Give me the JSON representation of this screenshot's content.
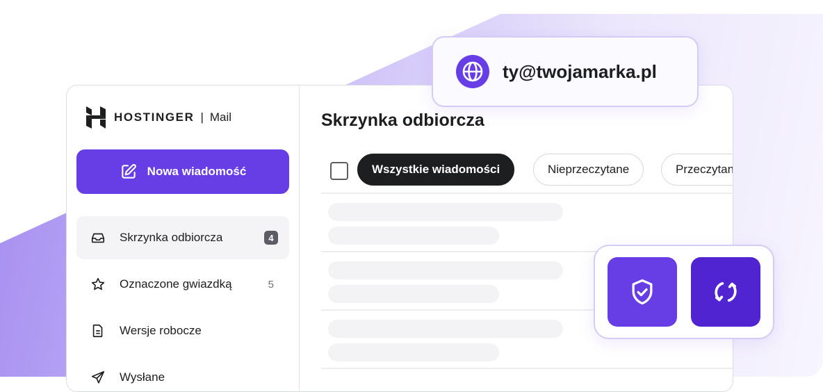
{
  "brand": {
    "name": "HOSTINGER",
    "separator": "|",
    "product": "Mail"
  },
  "compose_button": {
    "label": "Nowa wiadomość",
    "icon": "compose-icon"
  },
  "sidebar": {
    "items": [
      {
        "label": "Skrzynka odbiorcza",
        "icon": "inbox-icon",
        "badge": "4",
        "active": true
      },
      {
        "label": "Oznaczone gwiazdką",
        "icon": "star-icon",
        "count": "5"
      },
      {
        "label": "Wersje robocze",
        "icon": "draft-document-icon"
      },
      {
        "label": "Wysłane",
        "icon": "send-icon"
      }
    ]
  },
  "main": {
    "title": "Skrzynka odbiorcza",
    "filters": [
      {
        "label": "Wszystkie wiadomości",
        "active": true
      },
      {
        "label": "Nieprzeczytane"
      },
      {
        "label": "Przeczytane"
      }
    ]
  },
  "email_chip": {
    "address": "ty@twojamarka.pl",
    "icon": "globe-icon"
  },
  "feature_tiles": [
    {
      "icon": "shield-check-icon"
    },
    {
      "icon": "sync-icon"
    }
  ],
  "colors": {
    "accent": "#673de6",
    "accent_dark": "#5025d1",
    "text": "#1d1e20",
    "active_filter_bg": "#1d1e20",
    "badge_bg": "#5b5c66"
  }
}
